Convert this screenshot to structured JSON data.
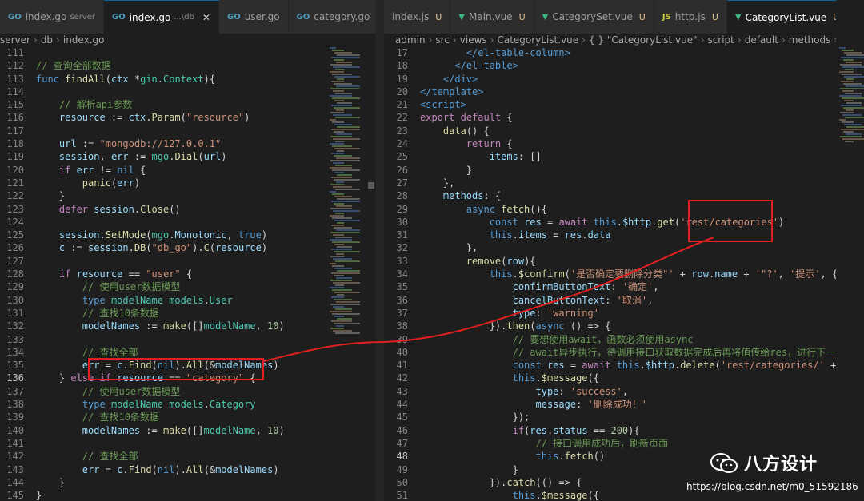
{
  "left_editor": {
    "tabs": [
      {
        "icon": "GO",
        "name": "index.go",
        "sub": "server",
        "active": false
      },
      {
        "icon": "GO",
        "name": "index.go",
        "sub": "...\\db",
        "active": true,
        "close": "✕"
      },
      {
        "icon": "GO",
        "name": "user.go",
        "sub": "",
        "active": false
      },
      {
        "icon": "GO",
        "name": "category.go",
        "sub": "",
        "active": false
      }
    ],
    "overflow": "···",
    "breadcrumb": [
      "server",
      "db",
      "index.go"
    ],
    "breadcrumb_icon": "GO",
    "current_line": "136",
    "lines": [
      {
        "n": "111",
        "h": ""
      },
      {
        "n": "112",
        "h": "<span class=\"c\">// 查询全部数据</span>"
      },
      {
        "n": "113",
        "h": "<span class=\"k\">func</span> <span class=\"f\">findAll</span>(<span class=\"v\">ctx</span> *<span class=\"t\">gin</span>.<span class=\"t\">Context</span>){"
      },
      {
        "n": "114",
        "h": ""
      },
      {
        "n": "115",
        "h": "    <span class=\"c\">// 解析api参数</span>"
      },
      {
        "n": "116",
        "h": "    <span class=\"v\">resource</span> := <span class=\"v\">ctx</span>.<span class=\"f\">Param</span>(<span class=\"s\">\"resource\"</span>)"
      },
      {
        "n": "117",
        "h": ""
      },
      {
        "n": "118",
        "h": "    <span class=\"v\">url</span> := <span class=\"s\">\"mongodb://127.0.0.1\"</span>"
      },
      {
        "n": "119",
        "h": "    <span class=\"v\">session</span>, <span class=\"v\">err</span> := <span class=\"t\">mgo</span>.<span class=\"f\">Dial</span>(<span class=\"v\">url</span>)"
      },
      {
        "n": "120",
        "h": "    <span class=\"kc\">if</span> <span class=\"v\">err</span> != <span class=\"k\">nil</span> {"
      },
      {
        "n": "121",
        "h": "        <span class=\"f\">panic</span>(<span class=\"v\">err</span>)"
      },
      {
        "n": "122",
        "h": "    }"
      },
      {
        "n": "123",
        "h": "    <span class=\"kc\">defer</span> <span class=\"v\">session</span>.<span class=\"f\">Close</span>()"
      },
      {
        "n": "124",
        "h": ""
      },
      {
        "n": "125",
        "h": "    <span class=\"v\">session</span>.<span class=\"f\">SetMode</span>(<span class=\"t\">mgo</span>.<span class=\"v\">Monotonic</span>, <span class=\"k\">true</span>)"
      },
      {
        "n": "126",
        "h": "    <span class=\"v\">c</span> := <span class=\"v\">session</span>.<span class=\"f\">DB</span>(<span class=\"s\">\"db_go\"</span>).<span class=\"f\">C</span>(<span class=\"v\">resource</span>)"
      },
      {
        "n": "127",
        "h": ""
      },
      {
        "n": "128",
        "h": "    <span class=\"kc\">if</span> <span class=\"v\">resource</span> == <span class=\"s\">\"user\"</span> {"
      },
      {
        "n": "129",
        "h": "        <span class=\"c\">// 使用user数据模型</span>"
      },
      {
        "n": "130",
        "h": "        <span class=\"k\">type</span> <span class=\"t\">modelName</span> <span class=\"t\">models</span>.<span class=\"t\">User</span>"
      },
      {
        "n": "131",
        "h": "        <span class=\"c\">// 查找10条数据</span>"
      },
      {
        "n": "132",
        "h": "        <span class=\"v\">modelNames</span> := <span class=\"f\">make</span>([]<span class=\"t\">modelName</span>, <span class=\"n\">10</span>)"
      },
      {
        "n": "133",
        "h": ""
      },
      {
        "n": "134",
        "h": "        <span class=\"c\">// 查找全部</span>"
      },
      {
        "n": "135",
        "h": "        <span class=\"v\">err</span> = <span class=\"v\">c</span>.<span class=\"f\">Find</span>(<span class=\"k\">nil</span>).<span class=\"f\">All</span>(&amp;<span class=\"v\">modelNames</span>)"
      },
      {
        "n": "136",
        "h": "    } <span class=\"kc\">else</span> <span class=\"kc\">if</span> <span class=\"v\">resource</span> == <span class=\"s\">\"category\"</span> {"
      },
      {
        "n": "137",
        "h": "        <span class=\"c\">// 使用user数据模型</span>"
      },
      {
        "n": "138",
        "h": "        <span class=\"k\">type</span> <span class=\"t\">modelName</span> <span class=\"t\">models</span>.<span class=\"t\">Category</span>"
      },
      {
        "n": "139",
        "h": "        <span class=\"c\">// 查找10条数据</span>"
      },
      {
        "n": "140",
        "h": "        <span class=\"v\">modelNames</span> := <span class=\"f\">make</span>([]<span class=\"t\">modelName</span>, <span class=\"n\">10</span>)"
      },
      {
        "n": "141",
        "h": ""
      },
      {
        "n": "142",
        "h": "        <span class=\"c\">// 查找全部</span>"
      },
      {
        "n": "143",
        "h": "        <span class=\"v\">err</span> = <span class=\"v\">c</span>.<span class=\"f\">Find</span>(<span class=\"k\">nil</span>).<span class=\"f\">All</span>(&amp;<span class=\"v\">modelNames</span>)"
      },
      {
        "n": "144",
        "h": "    }"
      },
      {
        "n": "145",
        "h": "}"
      }
    ]
  },
  "right_editor": {
    "tabs": [
      {
        "icon": "",
        "name": "index.js",
        "mod": "U",
        "active": false
      },
      {
        "icon": "V",
        "name": "Main.vue",
        "mod": "U",
        "active": false
      },
      {
        "icon": "V",
        "name": "CategorySet.vue",
        "mod": "U",
        "active": false
      },
      {
        "icon": "JS",
        "name": "http.js",
        "mod": "U",
        "active": false
      },
      {
        "icon": "V",
        "name": "CategoryList.vue",
        "mod": "U",
        "active": true,
        "close": "✕"
      }
    ],
    "breadcrumb": [
      "admin",
      "src",
      "views",
      "CategoryList.vue",
      "{ } \"CategoryList.vue\"",
      "script",
      "default",
      "methods",
      "remov"
    ],
    "current_line": "48",
    "lines": [
      {
        "n": "17",
        "h": "        <span class=\"tag\">&lt;/el-table-column&gt;</span>"
      },
      {
        "n": "18",
        "h": "      <span class=\"tag\">&lt;/el-table&gt;</span>"
      },
      {
        "n": "19",
        "h": "    <span class=\"tag\">&lt;/div&gt;</span>"
      },
      {
        "n": "20",
        "h": "<span class=\"tag\">&lt;/template&gt;</span>"
      },
      {
        "n": "21",
        "h": "<span class=\"tag\">&lt;script&gt;</span>"
      },
      {
        "n": "22",
        "h": "<span class=\"kc\">export</span> <span class=\"kc\">default</span> {"
      },
      {
        "n": "23",
        "h": "    <span class=\"f\">data</span>() {"
      },
      {
        "n": "24",
        "h": "        <span class=\"kc\">return</span> {"
      },
      {
        "n": "25",
        "h": "            <span class=\"v\">items</span>: []"
      },
      {
        "n": "26",
        "h": "        }"
      },
      {
        "n": "27",
        "h": "    },"
      },
      {
        "n": "28",
        "h": "    <span class=\"v\">methods</span>: {"
      },
      {
        "n": "29",
        "h": "        <span class=\"k\">async</span> <span class=\"f\">fetch</span>(){"
      },
      {
        "n": "30",
        "h": "            <span class=\"k\">const</span> <span class=\"v\">res</span> = <span class=\"kc\">await</span> <span class=\"k\">this</span>.<span class=\"v\">$http</span>.<span class=\"f\">get</span>(<span class=\"s\">'rest/categories'</span>)"
      },
      {
        "n": "31",
        "h": "            <span class=\"k\">this</span>.<span class=\"v\">items</span> = <span class=\"v\">res</span>.<span class=\"v\">data</span>"
      },
      {
        "n": "32",
        "h": "        },"
      },
      {
        "n": "33",
        "h": "        <span class=\"f\">remove</span>(<span class=\"v\">row</span>){"
      },
      {
        "n": "34",
        "h": "            <span class=\"k\">this</span>.<span class=\"f\">$confirm</span>(<span class=\"s\">'是否确定要删除分类\"'</span> + <span class=\"v\">row</span>.<span class=\"v\">name</span> + <span class=\"s\">'\"?'</span>, <span class=\"s\">'提示'</span>, {"
      },
      {
        "n": "35",
        "h": "                <span class=\"v\">confirmButtonText</span>: <span class=\"s\">'确定'</span>,"
      },
      {
        "n": "36",
        "h": "                <span class=\"v\">cancelButtonText</span>: <span class=\"s\">'取消'</span>,"
      },
      {
        "n": "37",
        "h": "                <span class=\"v\">type</span>: <span class=\"s\">'warning'</span>"
      },
      {
        "n": "38",
        "h": "            }).<span class=\"f\">then</span>(<span class=\"k\">async</span> () =&gt; {"
      },
      {
        "n": "39",
        "h": "                <span class=\"c\">// 要想使用await，函数必须使用async</span>"
      },
      {
        "n": "40",
        "h": "                <span class=\"c\">// await异步执行，待调用接口获取数据完成后再将值传给res，进行下一步</span>"
      },
      {
        "n": "41",
        "h": "                <span class=\"k\">const</span> <span class=\"v\">res</span> = <span class=\"kc\">await</span> <span class=\"k\">this</span>.<span class=\"v\">$http</span>.<span class=\"f\">delete</span>(<span class=\"s\">'rest/categories/'</span> + <span class=\"v\">row</span>."
      },
      {
        "n": "42",
        "h": "                <span class=\"k\">this</span>.<span class=\"f\">$message</span>({"
      },
      {
        "n": "43",
        "h": "                    <span class=\"v\">type</span>: <span class=\"s\">'success'</span>,"
      },
      {
        "n": "44",
        "h": "                    <span class=\"v\">message</span>: <span class=\"s\">'删除成功！'</span>"
      },
      {
        "n": "45",
        "h": "                });"
      },
      {
        "n": "46",
        "h": "                <span class=\"kc\">if</span>(<span class=\"v\">res</span>.<span class=\"v\">status</span> == <span class=\"n\">200</span>){"
      },
      {
        "n": "47",
        "h": "                    <span class=\"c\">// 接口调用成功后，刷新页面</span>"
      },
      {
        "n": "48",
        "h": "                    <span class=\"k\">this</span>.<span class=\"f\">fetch</span>()"
      },
      {
        "n": "49",
        "h": "                }"
      },
      {
        "n": "50",
        "h": "            }).<span class=\"f\">catch</span>(() =&gt; {"
      },
      {
        "n": "51",
        "h": "                <span class=\"k\">this</span>.<span class=\"f\">$message</span>({"
      }
    ]
  },
  "watermark": {
    "text": "八方设计",
    "url": "https://blog.csdn.net/m0_51592186"
  },
  "colors": {
    "annotation": "#e02020",
    "editor_bg": "#1e1e1e",
    "tab_bar": "#252526"
  }
}
